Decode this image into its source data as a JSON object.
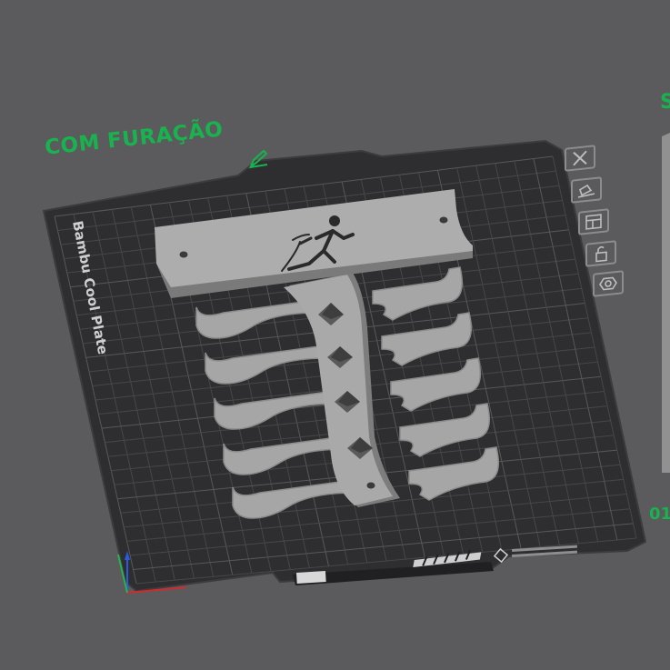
{
  "plate": {
    "title": "COM FURAÇÃO",
    "bed_name": "Bambu Cool Plate",
    "edit_icon": "pencil-icon"
  },
  "toolbar": {
    "tools": [
      {
        "name": "close-plate-button",
        "icon": "close-icon"
      },
      {
        "name": "auto-orient-button",
        "icon": "orient-icon"
      },
      {
        "name": "arrange-button",
        "icon": "arrange-icon"
      },
      {
        "name": "lock-plate-button",
        "icon": "unlock-icon"
      },
      {
        "name": "plate-settings-button",
        "icon": "gear-hex-icon"
      }
    ]
  },
  "cut_labels": {
    "right": "S",
    "bottom": "01"
  },
  "colors": {
    "background": "#5b5b5d",
    "plate": "#2e2e30",
    "grid": "#4a4a4c",
    "model": "#a9a9a9",
    "accent": "#18b34e"
  }
}
